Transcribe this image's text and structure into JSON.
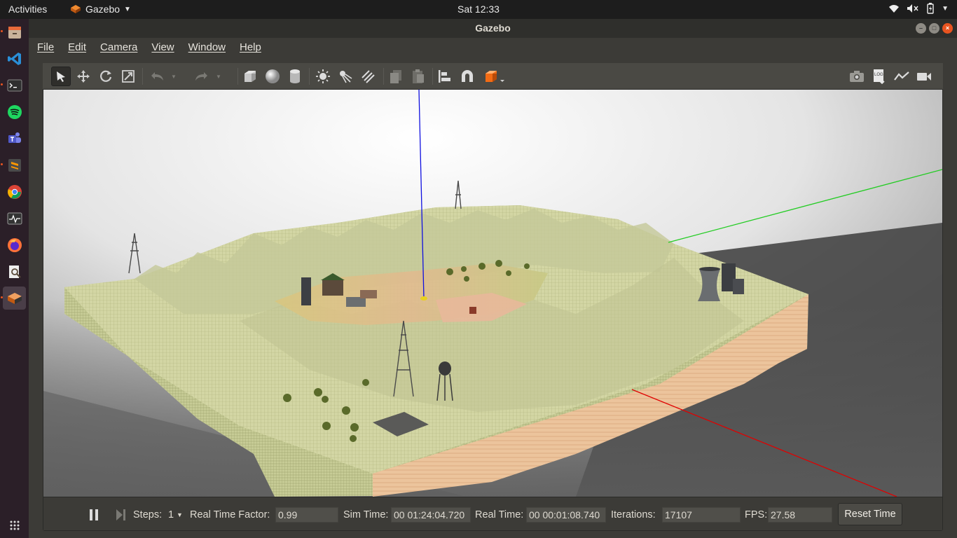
{
  "topbar": {
    "activities": "Activities",
    "app_name": "Gazebo",
    "clock": "Sat 12:33"
  },
  "window": {
    "title": "Gazebo"
  },
  "menu": {
    "file": "File",
    "edit": "Edit",
    "camera": "Camera",
    "view": "View",
    "window": "Window",
    "help": "Help"
  },
  "toolbar": {
    "left_icons": [
      "select-arrow-icon",
      "translate-icon",
      "rotate-icon",
      "scale-icon",
      "undo-icon",
      "redo-icon",
      "box-icon",
      "sphere-icon",
      "cylinder-icon",
      "point-light-icon",
      "spot-light-icon",
      "directional-light-icon",
      "copy-icon",
      "paste-icon",
      "align-icon",
      "snap-magnet-icon",
      "view-angle-icon"
    ],
    "right_icons": [
      "screenshot-camera-icon",
      "log-icon",
      "plot-icon",
      "video-record-icon"
    ]
  },
  "status": {
    "steps_label": "Steps:",
    "steps_value": "1",
    "rtf_label": "Real Time Factor:",
    "rtf_value": "0.99",
    "sim_time_label": "Sim Time:",
    "sim_time_value": "00 01:24:04.720",
    "real_time_label": "Real Time:",
    "real_time_value": "00 00:01:08.740",
    "iterations_label": "Iterations:",
    "iterations_value": "17107",
    "fps_label": "FPS:",
    "fps_value": "27.58",
    "reset_label": "Reset Time"
  },
  "colors": {
    "accent": "#e95420",
    "axis_x": "#e00000",
    "axis_y": "#22cc22",
    "axis_z": "#1010e0",
    "terrain": "#cfd3a2",
    "terrain_side": "#e9c8a2"
  }
}
